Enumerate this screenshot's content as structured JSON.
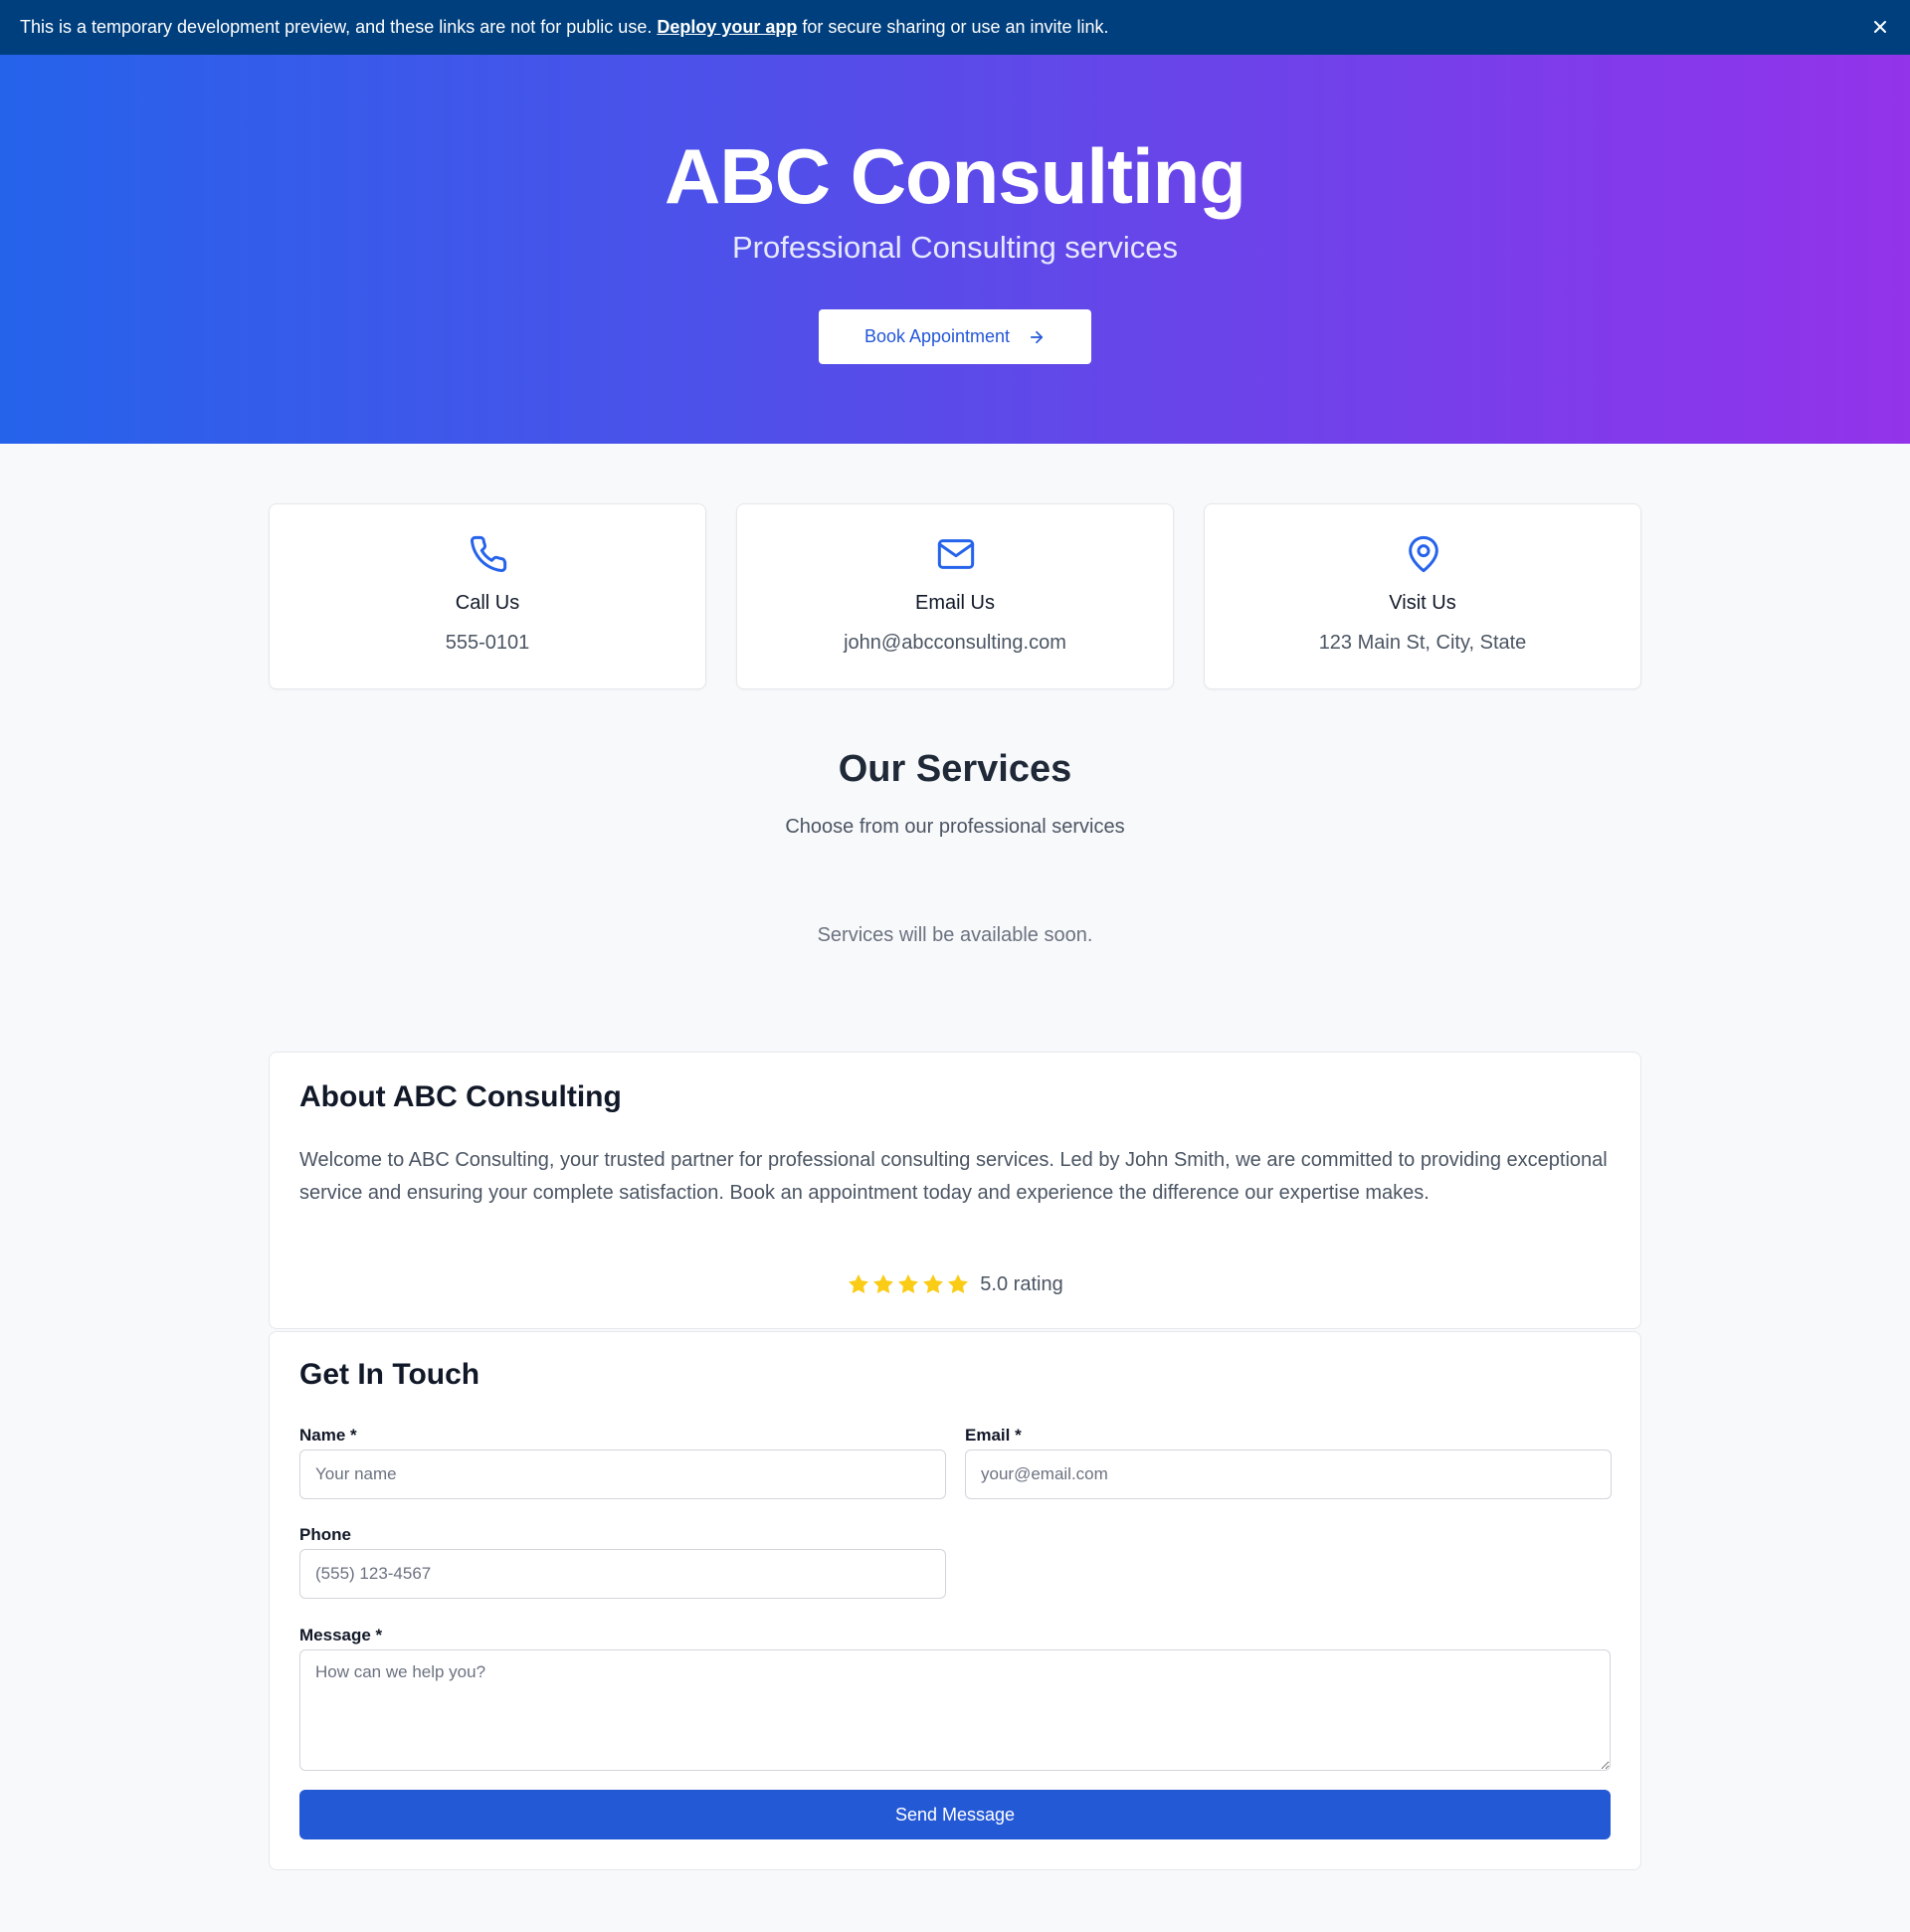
{
  "banner": {
    "message_before": "This is a temporary development preview, and these links are not for public use.",
    "link_text": "Deploy your app",
    "message_after": "for secure sharing or use an invite link."
  },
  "hero": {
    "title": "ABC Consulting",
    "tagline": "Professional Consulting services",
    "cta_label": "Book Appointment"
  },
  "contact_cards": [
    {
      "icon": "phone-icon",
      "title": "Call Us",
      "value": "555-0101"
    },
    {
      "icon": "mail-icon",
      "title": "Email Us",
      "value": "john@abcconsulting.com"
    },
    {
      "icon": "map-pin-icon",
      "title": "Visit Us",
      "value": "123 Main St, City, State"
    }
  ],
  "services": {
    "title": "Our Services",
    "subtitle": "Choose from our professional services",
    "empty_text": "Services will be available soon."
  },
  "about": {
    "title": "About ABC Consulting",
    "body": "Welcome to ABC Consulting, your trusted partner for professional consulting services. Led by John Smith, we are committed to providing exceptional service and ensuring your complete satisfaction. Book an appointment today and experience the difference our expertise makes.",
    "rating_value": 5,
    "rating_text": "5.0 rating"
  },
  "contact_form": {
    "title": "Get In Touch",
    "name_label": "Name *",
    "name_placeholder": "Your name",
    "email_label": "Email *",
    "email_placeholder": "your@email.com",
    "phone_label": "Phone",
    "phone_placeholder": "(555) 123-4567",
    "message_label": "Message *",
    "message_placeholder": "How can we help you?",
    "submit_label": "Send Message"
  },
  "colors": {
    "banner_bg": "#003f7d",
    "hero_gradient_start": "#2563eb",
    "hero_gradient_end": "#9333ea",
    "accent": "#2459d6",
    "star": "#facc15"
  }
}
